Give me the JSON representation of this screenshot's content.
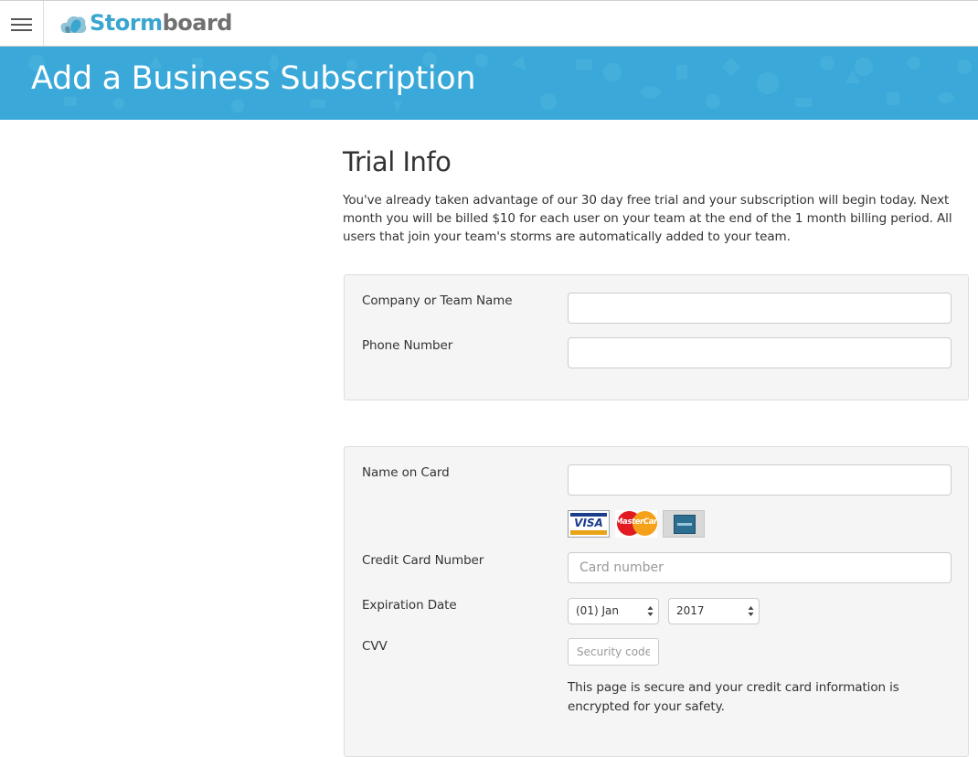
{
  "app": {
    "logo_part1": "Storm",
    "logo_part2": "board",
    "icons": {
      "menu": "hamburger-menu-icon",
      "logo": "stormboard-cloud-logo"
    }
  },
  "colors": {
    "brand_blue": "#3aa9d9",
    "logo_blue": "#3aa6cf",
    "logo_gray": "#707070",
    "panel_bg": "#f5f5f5"
  },
  "banner": {
    "title": "Add a Business Subscription"
  },
  "trial": {
    "title": "Trial Info",
    "description": "You've already taken advantage of our 30 day free trial and your subscription will begin today. Next month you will be billed $10 for each user on your team at the end of the 1 month billing period. All users that join your team's storms are automatically added to your team."
  },
  "company_form": {
    "company_label": "Company or Team Name",
    "company_value": "",
    "phone_label": "Phone Number",
    "phone_value": ""
  },
  "payment_form": {
    "name_label": "Name on Card",
    "name_value": "",
    "card_logos": {
      "visa": "VISA",
      "mastercard": "MasterCard"
    },
    "card_number_label": "Credit Card Number",
    "card_number_placeholder": "Card number",
    "expiration_label": "Expiration Date",
    "expiration_month": "(01) Jan",
    "expiration_year": "2017",
    "cvv_label": "CVV",
    "cvv_placeholder": "Security code",
    "secure_note": "This page is secure and your credit card information is encrypted for your safety."
  }
}
